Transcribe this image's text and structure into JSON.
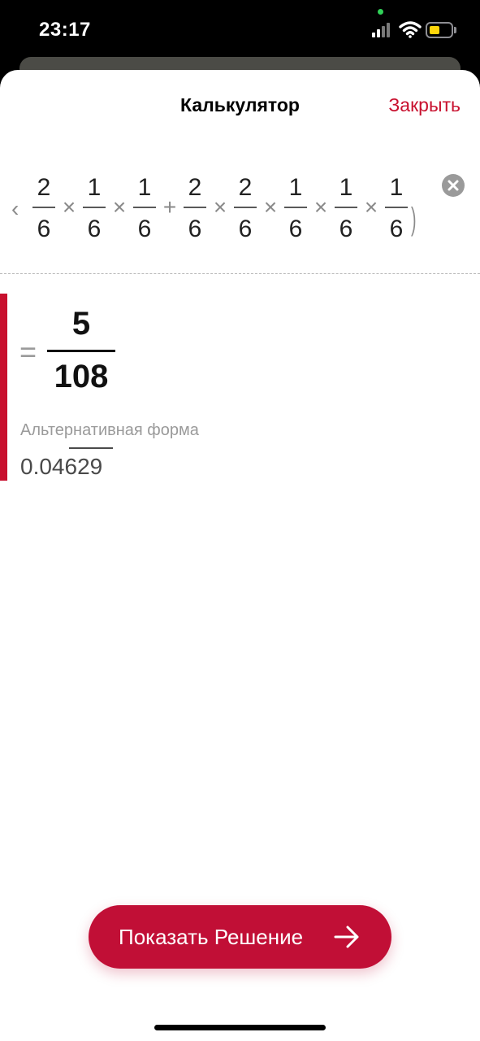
{
  "status_bar": {
    "time": "23:17"
  },
  "header": {
    "title": "Калькулятор",
    "close_label": "Закрыть"
  },
  "expression": {
    "left_glyph": "‹",
    "terms": [
      {
        "num": "2",
        "den": "6"
      },
      {
        "op": "×"
      },
      {
        "num": "1",
        "den": "6"
      },
      {
        "op": "×"
      },
      {
        "num": "1",
        "den": "6"
      },
      {
        "op": "+"
      },
      {
        "num": "2",
        "den": "6"
      },
      {
        "op": "×"
      },
      {
        "num": "2",
        "den": "6"
      },
      {
        "op": "×"
      },
      {
        "num": "1",
        "den": "6"
      },
      {
        "op": "×"
      },
      {
        "num": "1",
        "den": "6"
      },
      {
        "op": "×"
      },
      {
        "num": "1",
        "den": "6"
      }
    ],
    "closing_paren": ")"
  },
  "result": {
    "equals_sign": "=",
    "numerator": "5",
    "denominator": "108",
    "alternative_label": "Альтернативная форма",
    "alternative_value": "0.04629"
  },
  "action": {
    "show_solution_label": "Показать Решение"
  },
  "colors": {
    "accent": "#c8102e",
    "button": "#c10f36",
    "muted": "#9a9a9a"
  },
  "icons": {
    "clear": "clear-icon",
    "arrow": "arrow-right-icon",
    "signal": "signal-icon",
    "wifi": "wifi-icon",
    "battery": "battery-icon"
  }
}
